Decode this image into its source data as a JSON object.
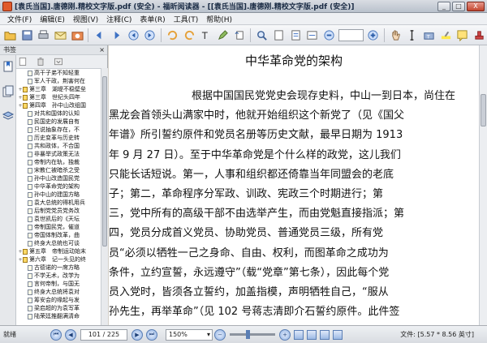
{
  "window": {
    "title": "[袁氏当国].唐德刚.精校文字版.pdf (安全) - 福昕阅读器 - [[袁氏当国].唐德刚.精校文字版.pdf (安全)]",
    "minimize": "_",
    "maximize": "□",
    "close": "X"
  },
  "menu": [
    "文件(F)",
    "编辑(E)",
    "视图(V)",
    "注释(C)",
    "表单(R)",
    "工具(T)",
    "帮助(H)"
  ],
  "toolbar": {
    "zoom_value": "",
    "icons": [
      "open-icon",
      "save-icon",
      "print-icon",
      "email-icon",
      "hand-icon",
      "select-icon",
      "snapshot-icon",
      "back-icon",
      "forward-icon",
      "first-page-icon",
      "prev-page-icon",
      "next-page-icon",
      "zoom-icon",
      "fit-page-icon",
      "fit-width-icon",
      "rotate-icon",
      "zoom-out-icon",
      "zoom-in-icon",
      "hand-tool-icon",
      "text-select-icon",
      "typewriter-icon",
      "highlight-icon",
      "note-icon",
      "stamp-icon"
    ]
  },
  "sidebar": {
    "header": "书签",
    "close": "×",
    "bookmarks": [
      {
        "level": 2,
        "text": "高干子弟不知轻重",
        "chapter": false
      },
      {
        "level": 2,
        "text": "军人干政，荆害何在",
        "chapter": false
      },
      {
        "level": 1,
        "text": "第三章　湖堤不稳壁垒",
        "chapter": true
      },
      {
        "level": 1,
        "text": "第三章　世纪头四年",
        "chapter": true
      },
      {
        "level": 1,
        "text": "第四章　孙中山改组国",
        "chapter": true
      },
      {
        "level": 2,
        "text": "对共和国体的认知",
        "chapter": false
      },
      {
        "level": 2,
        "text": "民国史的发展自有",
        "chapter": false
      },
      {
        "level": 2,
        "text": "只说抽象存在，不",
        "chapter": false
      },
      {
        "level": 2,
        "text": "历史变革与历史转",
        "chapter": false
      },
      {
        "level": 2,
        "text": "共和政体，不合国",
        "chapter": false
      },
      {
        "level": 2,
        "text": "非暴举式政策无法",
        "chapter": false
      },
      {
        "level": 2,
        "text": "帝制内在轨，独裁",
        "chapter": false
      },
      {
        "level": 2,
        "text": "宋教仁被暗杀之受",
        "chapter": false
      },
      {
        "level": 2,
        "text": "孙中山改造国民党",
        "chapter": false
      },
      {
        "level": 2,
        "text": "中华革命党的架构",
        "chapter": false
      },
      {
        "level": 2,
        "text": "孙中山的建国方略",
        "chapter": false
      },
      {
        "level": 2,
        "text": "袁大总统的得机用兵",
        "chapter": false
      },
      {
        "level": 2,
        "text": "后制党党员党务改",
        "chapter": false
      },
      {
        "level": 2,
        "text": "袁世凯后的《天坛",
        "chapter": false
      },
      {
        "level": 2,
        "text": "帝制国民党，催道",
        "chapter": false
      },
      {
        "level": 2,
        "text": "帝国体制改革，曲",
        "chapter": false
      },
      {
        "level": 2,
        "text": "终身大总统也可谈",
        "chapter": false
      },
      {
        "level": 1,
        "text": "第五章　帝制运动始末",
        "chapter": true
      },
      {
        "level": 1,
        "text": "第六章　记一头见的终",
        "chapter": true
      },
      {
        "level": 2,
        "text": "古德诺的一席方略",
        "chapter": false
      },
      {
        "level": 2,
        "text": "不学无术，改学为",
        "chapter": false
      },
      {
        "level": 2,
        "text": "言何帝制，与国无",
        "chapter": false
      },
      {
        "level": 2,
        "text": "终身大总统将袁对",
        "chapter": false
      },
      {
        "level": 2,
        "text": "筹安会的缘起与发",
        "chapter": false
      },
      {
        "level": 2,
        "text": "梁启超的为袁写革",
        "chapter": false
      },
      {
        "level": 2,
        "text": "陆荣廷推翻满清命",
        "chapter": false
      }
    ]
  },
  "document": {
    "heading": "中华革命党的架构",
    "lines": [
      "根据中国国民党党史会现存史料，中山一到日本，尚住在",
      "黑龙会首领头山满家中时，他就开始组织这个新党了（见《国父",
      "年谱》所引誓约原件和党员名册等历史文献，最早日期为 1913",
      "年 9 月 27 日）。至于中华革命党是个什么样的政党，这儿我们",
      "只能长话短说。第一，人事和组织都还倚靠当年同盟会的老底",
      "子；第二，革命程序分军政、训政、宪政三个时期进行；第",
      "三，党中所有的高级干部不由选举产生，而由党魁直接指派；第",
      "四，党员分成首义党员、协助党员、普通党员三级，所有党",
      "员“必须以牺牲一己之身命、自由、权利，而图革命之成功为",
      "条件，立约宣誓，永远遵守”（载“党章”第七条），因此每个党",
      "员入党时，皆须各立誓约，加盖指模，声明牺牲自己，“服从",
      "孙先生，再举革命”（见 102 号蒋志清即介石誓约原件。此件签"
    ]
  },
  "status": {
    "ready": "就绪",
    "page_display": "101 / 225",
    "zoom": "150%",
    "file_info": "文件: [5.57 * 8.56 英寸]"
  }
}
